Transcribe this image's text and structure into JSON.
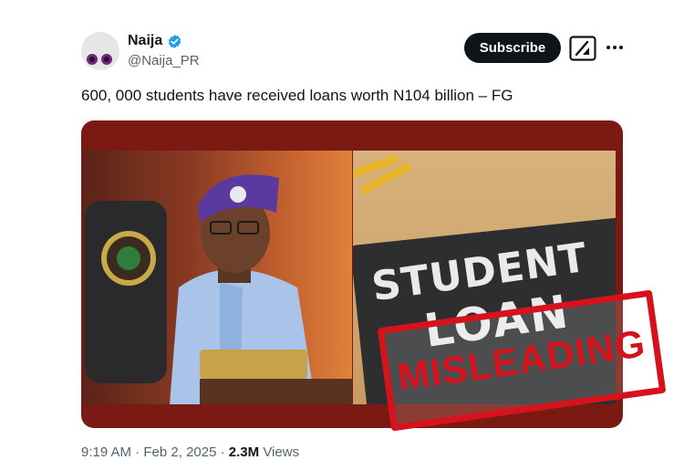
{
  "author": {
    "name": "Naija",
    "handle": "@Naija_PR",
    "verified": true
  },
  "actions": {
    "subscribe_label": "Subscribe",
    "grok_icon": "grok-icon",
    "more_icon": "more-options-icon"
  },
  "tweet": {
    "text": "600, 000 students have received loans worth N104 billion – FG"
  },
  "media": {
    "board_line1": "STUDENT",
    "board_line2": "LOAN",
    "stamp_label": "MISLEADING",
    "accent_color": "#d6121c",
    "frame_color": "#7a1a12"
  },
  "meta": {
    "time": "9:19 AM",
    "separator": "·",
    "date": "Feb 2, 2025",
    "views_count": "2.3M",
    "views_label": "Views"
  },
  "colors": {
    "verified_blue": "#1d9bf0",
    "button_bg": "#0f1419",
    "secondary_text": "#536471"
  }
}
